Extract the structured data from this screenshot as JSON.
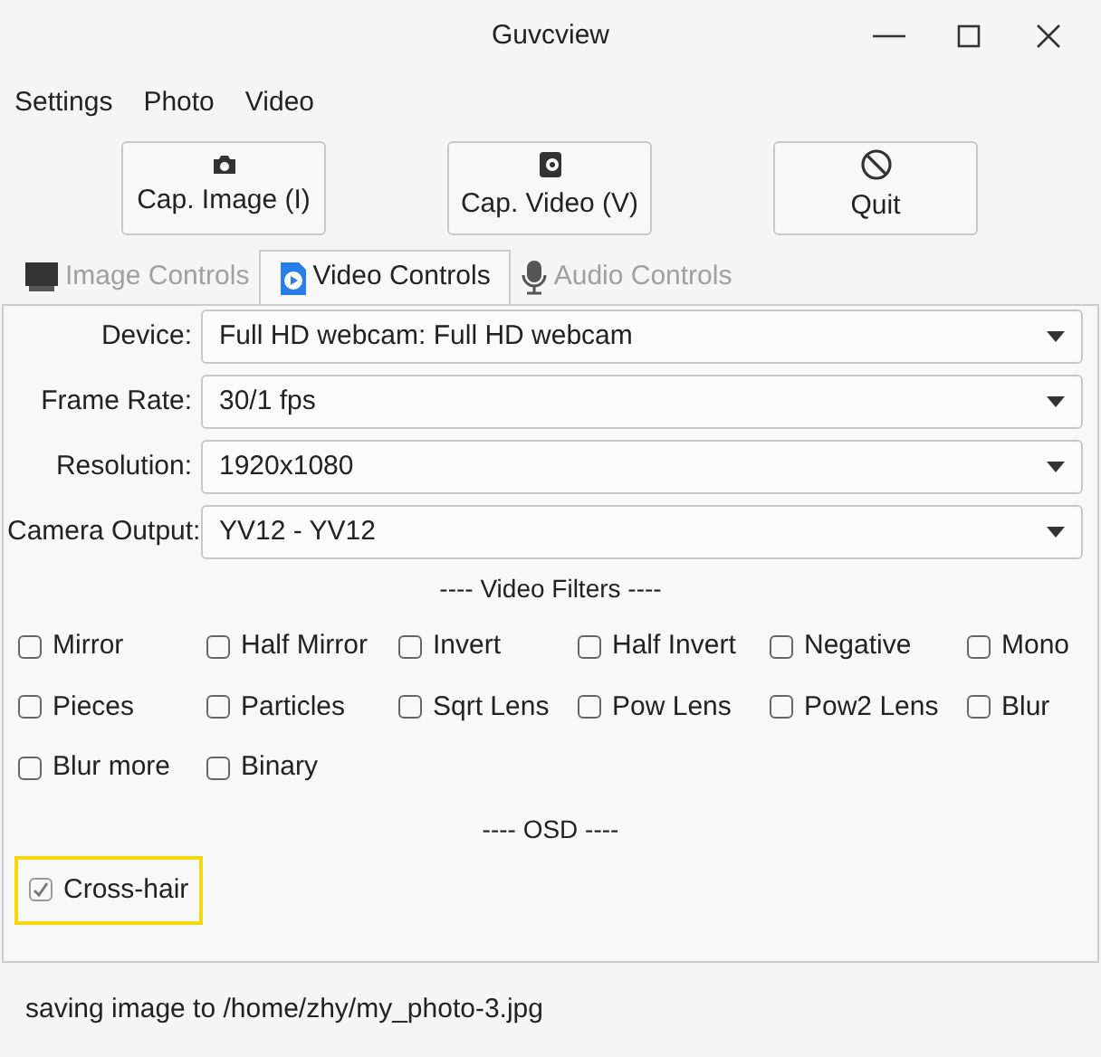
{
  "window": {
    "title": "Guvcview"
  },
  "menu": [
    "Settings",
    "Photo",
    "Video"
  ],
  "toolbar": [
    {
      "kind": "camera",
      "label": "Cap. Image (I)"
    },
    {
      "kind": "video",
      "label": "Cap. Video (V)"
    },
    {
      "kind": "quit",
      "label": "Quit"
    }
  ],
  "tabs": [
    {
      "kind": "image",
      "label": "Image Controls",
      "selected": false,
      "disabled": true
    },
    {
      "kind": "video",
      "label": "Video Controls",
      "selected": true,
      "disabled": false
    },
    {
      "kind": "audio",
      "label": "Audio Controls",
      "selected": false,
      "disabled": true
    }
  ],
  "fields": [
    {
      "label": "Device:",
      "value": "Full HD webcam: Full HD webcam"
    },
    {
      "label": "Frame Rate:",
      "value": "30/1 fps"
    },
    {
      "label": "Resolution:",
      "value": "1920x1080"
    },
    {
      "label": "Camera Output:",
      "value": "YV12 - YV12"
    }
  ],
  "filters_heading": "---- Video Filters ----",
  "filters": [
    {
      "label": "Mirror",
      "checked": false
    },
    {
      "label": "Half Mirror",
      "checked": false
    },
    {
      "label": "Invert",
      "checked": false
    },
    {
      "label": "Half Invert",
      "checked": false
    },
    {
      "label": "Negative",
      "checked": false
    },
    {
      "label": "Mono",
      "checked": false
    },
    {
      "label": "Pieces",
      "checked": false
    },
    {
      "label": "Particles",
      "checked": false
    },
    {
      "label": "Sqrt Lens",
      "checked": false
    },
    {
      "label": "Pow Lens",
      "checked": false
    },
    {
      "label": "Pow2 Lens",
      "checked": false
    },
    {
      "label": "Blur",
      "checked": false
    },
    {
      "label": "Blur more",
      "checked": false
    },
    {
      "label": "Binary",
      "checked": false
    }
  ],
  "osd_heading": "---- OSD ----",
  "osd": [
    {
      "label": "Cross-hair",
      "checked": true,
      "focused": true
    }
  ],
  "status_bar": "saving image to /home/zhy/my_photo-3.jpg"
}
